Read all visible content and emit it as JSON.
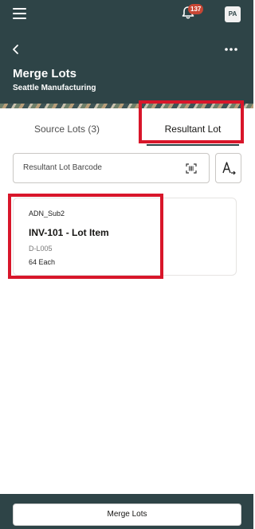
{
  "topbar": {
    "notification_count": "137",
    "avatar_initials": "PA"
  },
  "page": {
    "title": "Merge Lots",
    "subtitle": "Seattle Manufacturing"
  },
  "tabs": [
    {
      "label": "Source Lots (3)",
      "selected": false
    },
    {
      "label": "Resultant Lot",
      "selected": true
    }
  ],
  "search": {
    "placeholder": "Resultant Lot Barcode"
  },
  "lot_card": {
    "subinventory": "ADN_Sub2",
    "item": "INV-101 - Lot Item",
    "lot": "D-L005",
    "quantity": "64 Each"
  },
  "footer": {
    "merge_label": "Merge Lots"
  },
  "colors": {
    "header": "#2e4447",
    "highlight": "#d8162a",
    "badge": "#c74634"
  },
  "icons": [
    "hamburger-icon",
    "bell-icon",
    "back-arrow-icon",
    "more-icon",
    "barcode-scan-icon",
    "sort-icon"
  ]
}
